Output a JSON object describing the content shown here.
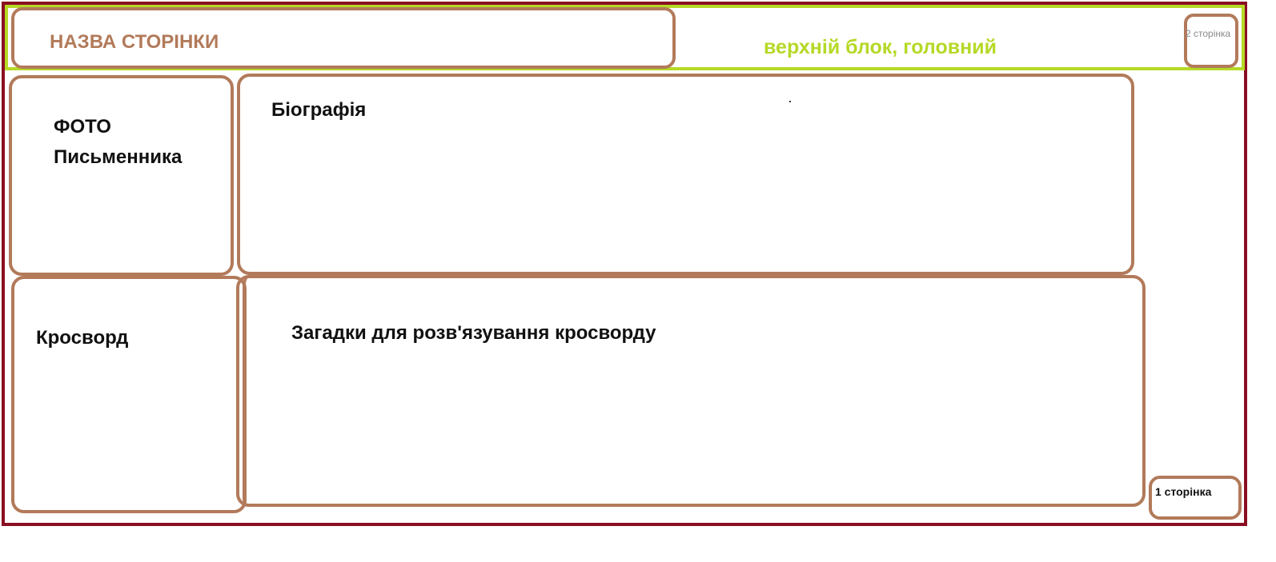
{
  "header": {
    "page_title_label": "НАЗВА СТОРІНКИ",
    "top_block_label": "верхній блок, головний",
    "page2_link_label": "2 сторінка"
  },
  "blocks": {
    "photo_label_line1": "ФОТО",
    "photo_label_line2": "Письменника",
    "biography_label": "Біографія",
    "crossword_label": "Кросворд",
    "riddles_label": "Загадки для розв'язування кросворду"
  },
  "footer": {
    "page1_link_label": "1 сторінка"
  },
  "colors": {
    "outer_border": "#8a0f22",
    "top_bar_border": "#b5d926",
    "box_border": "#b27a5a",
    "title_text": "#b27a5a",
    "green_text": "#b5d926"
  }
}
